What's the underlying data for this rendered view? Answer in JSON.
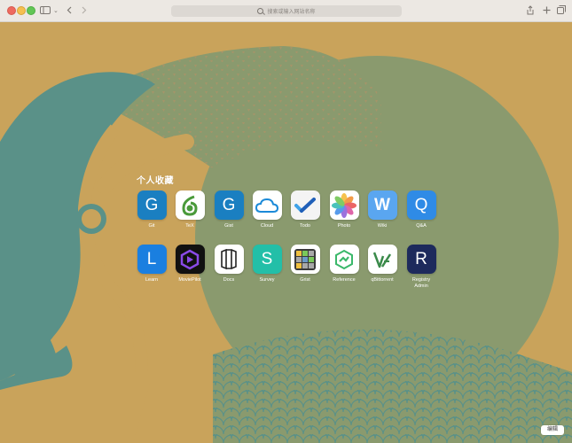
{
  "toolbar": {
    "address_placeholder": "搜索或输入网站名称"
  },
  "favorites": {
    "title": "个人收藏",
    "row1": [
      {
        "label": "Git",
        "letter": "G",
        "color": "#1a7fc1",
        "icon": "git-icon"
      },
      {
        "label": "TeX",
        "letter": "",
        "color": "#ffffff",
        "icon": "overleaf-icon"
      },
      {
        "label": "Gist",
        "letter": "G",
        "color": "#1a7fc1",
        "icon": "gist-icon"
      },
      {
        "label": "Cloud",
        "letter": "",
        "color": "#ffffff",
        "icon": "cloud-icon"
      },
      {
        "label": "Todo",
        "letter": "",
        "color": "#ffffff",
        "icon": "todo-check-icon"
      },
      {
        "label": "Photo",
        "letter": "",
        "color": "#ffffff",
        "icon": "photo-pinwheel-icon"
      },
      {
        "label": "Wiki",
        "letter": "W",
        "color": "#5aa6f0",
        "icon": "wiki-icon"
      },
      {
        "label": "Q&A",
        "letter": "Q",
        "color": "#2f8be6",
        "icon": "qa-icon"
      }
    ],
    "row2": [
      {
        "label": "Learn",
        "letter": "L",
        "color": "#1a7fe0",
        "icon": "learn-icon"
      },
      {
        "label": "MoviePilot",
        "letter": "",
        "color": "#111111",
        "icon": "moviepilot-icon"
      },
      {
        "label": "Docs",
        "letter": "",
        "color": "#ffffff",
        "icon": "docs-book-icon"
      },
      {
        "label": "Survey",
        "letter": "S",
        "color": "#23bfa8",
        "icon": "survey-icon"
      },
      {
        "label": "Grist",
        "letter": "",
        "color": "#ffffff",
        "icon": "grist-icon"
      },
      {
        "label": "Reference",
        "letter": "",
        "color": "#ffffff",
        "icon": "reference-icon"
      },
      {
        "label": "qBittorrent",
        "letter": "",
        "color": "#ffffff",
        "icon": "qbittorrent-icon"
      },
      {
        "label": "Registry Admin",
        "letter": "R",
        "color": "#1d2a5c",
        "icon": "registry-icon"
      }
    ]
  },
  "edit_button": "编辑",
  "colors": {
    "background": "#c9a35b",
    "green": "#8a9a6e",
    "teal": "#5a9188"
  }
}
